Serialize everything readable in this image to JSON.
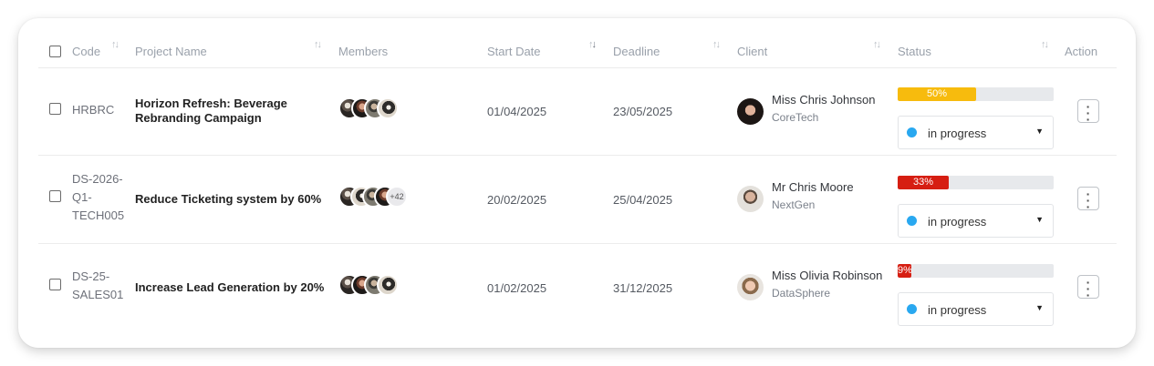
{
  "columns": {
    "code": "Code",
    "project_name": "Project Name",
    "members": "Members",
    "start_date": "Start Date",
    "deadline": "Deadline",
    "client": "Client",
    "status": "Status",
    "action": "Action"
  },
  "rows": [
    {
      "code": "HRBRC",
      "project_name": "Horizon Refresh: Beverage Rebranding Campaign",
      "members_more": "",
      "start_date": "01/04/2025",
      "deadline": "23/05/2025",
      "client_name": "Miss Chris Johnson",
      "client_company": "CoreTech",
      "progress_label": "50%",
      "progress": 0.5,
      "progress_color": "#f7bb0d",
      "status": "in progress"
    },
    {
      "code": "DS-2026-Q1-TECH005",
      "code_lines": [
        "DS-2026-",
        "Q1-",
        "TECH005"
      ],
      "project_name": "Reduce Ticketing system by 60%",
      "members_more": "+42",
      "start_date": "20/02/2025",
      "deadline": "25/04/2025",
      "client_name": "Mr Chris Moore",
      "client_company": "NextGen",
      "progress_label": "33%",
      "progress": 0.33,
      "progress_color": "#d61e12",
      "status": "in progress"
    },
    {
      "code": "DS-25-SALES01",
      "code_lines": [
        "DS-25-",
        "SALES01"
      ],
      "project_name": "Increase Lead Generation by 20%",
      "members_more": "",
      "start_date": "01/02/2025",
      "deadline": "31/12/2025",
      "client_name": "Miss Olivia Robinson",
      "client_company": "DataSphere",
      "progress_label": "9%",
      "progress": 0.09,
      "progress_color": "#d61e12",
      "status": "in progress"
    }
  ],
  "icons": {
    "sort": "sort-arrows-icon",
    "caret": "caret-down-icon",
    "action": "kebab-menu-icon",
    "status_dot": "status-dot-icon"
  },
  "colors": {
    "status_dot": "#29a8f0"
  }
}
